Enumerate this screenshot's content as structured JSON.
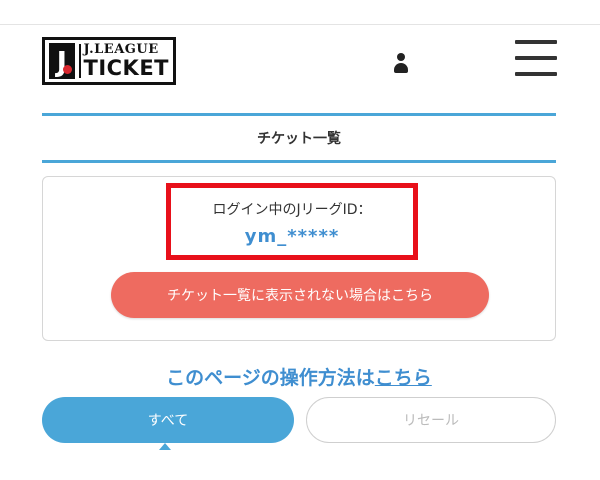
{
  "header": {
    "logo_mark": "J",
    "logo_top": "J.LEAGUE",
    "logo_bottom": "TICKET",
    "icons": [
      "user-icon",
      "hamburger-menu-icon"
    ]
  },
  "section": {
    "title": "チケット一覧"
  },
  "login": {
    "label": "ログイン中のJリーグID：",
    "id_value": "ym_*****",
    "help_button": "チケット一覧に表示されない場合はこちら"
  },
  "guide": {
    "text": "このページの操作方法は",
    "link": "こちら"
  },
  "tabs": [
    {
      "label": "すべて",
      "selected": true
    },
    {
      "label": "リセール",
      "selected": false
    }
  ],
  "colors": {
    "accent_blue": "#4aa6d8",
    "link_blue": "#3f8ed0",
    "warn_coral": "#ee6b60",
    "highlight_red": "#e8101a"
  }
}
